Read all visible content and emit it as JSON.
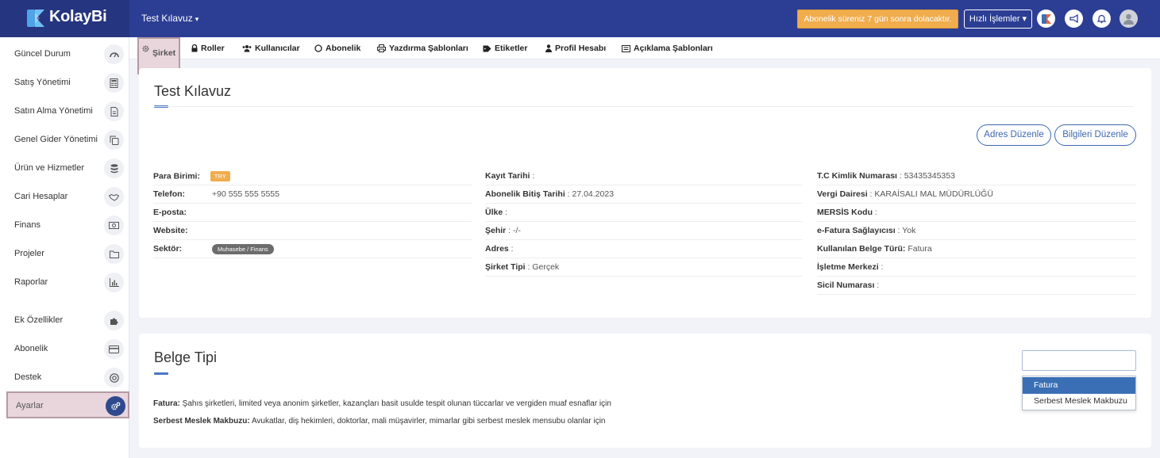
{
  "app": {
    "logo_text": "KolayBi",
    "company": "Test Kılavuz"
  },
  "topbar": {
    "subscription_notice": "Abonelik süreniz 7 gün sonra dolacaktır.",
    "quick_actions": "Hızlı İşlemler"
  },
  "sidebar": {
    "items": [
      {
        "label": "Güncel Durum",
        "icon": "dashboard-icon"
      },
      {
        "label": "Satış Yönetimi",
        "icon": "calculator-icon"
      },
      {
        "label": "Satın Alma Yönetimi",
        "icon": "document-icon"
      },
      {
        "label": "Genel Gider Yönetimi",
        "icon": "copy-icon"
      },
      {
        "label": "Ürün ve Hizmetler",
        "icon": "database-icon"
      },
      {
        "label": "Cari Hesaplar",
        "icon": "handshake-icon"
      },
      {
        "label": "Finans",
        "icon": "money-icon"
      },
      {
        "label": "Projeler",
        "icon": "folder-icon"
      },
      {
        "label": "Raporlar",
        "icon": "bar-chart-icon"
      },
      {
        "label": "Ek Özellikler",
        "icon": "puzzle-icon"
      },
      {
        "label": "Abonelik",
        "icon": "credit-card-icon"
      },
      {
        "label": "Destek",
        "icon": "lifebuoy-icon"
      },
      {
        "label": "Ayarlar",
        "icon": "cogs-icon",
        "active": true
      }
    ]
  },
  "tabs": [
    {
      "label": "Şirket",
      "icon": "gear-icon",
      "active": true
    },
    {
      "label": "Roller",
      "icon": "lock-icon"
    },
    {
      "label": "Kullanıcılar",
      "icon": "users-icon"
    },
    {
      "label": "Abonelik",
      "icon": "circle-icon"
    },
    {
      "label": "Yazdırma Şablonları",
      "icon": "printer-icon"
    },
    {
      "label": "Etiketler",
      "icon": "tag-icon"
    },
    {
      "label": "Profil Hesabı",
      "icon": "user-icon"
    },
    {
      "label": "Açıklama Şablonları",
      "icon": "list-icon"
    }
  ],
  "company_card": {
    "title": "Test Kılavuz",
    "edit_address": "Adres Düzenle",
    "edit_info": "Bilgileri Düzenle",
    "col1": [
      {
        "key": "Para Birimi:",
        "badge": "TRY"
      },
      {
        "key": "Telefon:",
        "value": "+90 555 555 5555"
      },
      {
        "key": "E-posta:",
        "value": ""
      },
      {
        "key": "Website:",
        "value": ""
      },
      {
        "key": "Sektör:",
        "tag": "Muhasebe / Finans"
      }
    ],
    "col2": [
      {
        "key": "Kayıt Tarihi",
        "value": " :"
      },
      {
        "key": "Abonelik Bitiş Tarihi",
        "value": " : 27.04.2023"
      },
      {
        "key": "Ülke",
        "value": " :"
      },
      {
        "key": "Şehir",
        "value": " : -/-"
      },
      {
        "key": "Adres",
        "value": " :"
      },
      {
        "key": "Şirket Tipi",
        "value": " : Gerçek"
      }
    ],
    "col3": [
      {
        "key": "T.C Kimlik Numarası",
        "value": " : 53435345353"
      },
      {
        "key": "Vergi Dairesi",
        "value": " : KARAİSALI MAL MÜDÜRLÜĞÜ"
      },
      {
        "key": "MERSİS Kodu",
        "value": " :"
      },
      {
        "key": "e-Fatura Sağlayıcısı",
        "value": " : Yok"
      },
      {
        "key": "Kullanılan Belge Türü:",
        "value": " Fatura"
      },
      {
        "key": "İşletme Merkezi",
        "value": " :"
      },
      {
        "key": "Sicil Numarası",
        "value": " :"
      }
    ]
  },
  "doc_card": {
    "title": "Belge Tipi",
    "desc1_key": "Fatura:",
    "desc1_text": " Şahıs şirketleri, limited veya anonim şirketler, kazançları basit usulde tespit olunan tüccarlar ve vergiden muaf esnaflar için",
    "desc2_key": "Serbest Meslek Makbuzu:",
    "desc2_text": " Avukatlar, diş hekimleri, doktorlar, mali müşavirler, mimarlar gibi serbest meslek mensubu olanlar için",
    "select_value": "",
    "options": [
      "Fatura",
      "Serbest Meslek Makbuzu"
    ],
    "highlighted_option": "Fatura"
  },
  "colors": {
    "topbar": "#2c3e94",
    "accent": "#3c68b0",
    "banner": "#f0ad4e",
    "active_highlight": "#e9d6dd"
  }
}
